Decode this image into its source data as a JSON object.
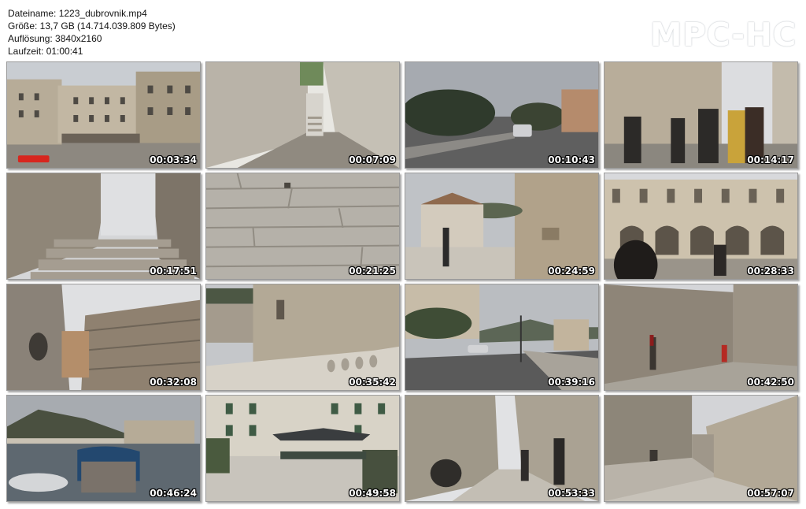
{
  "file_info": {
    "filename_line": "Dateiname: 1223_dubrovnik.mp4",
    "size_line": "Größe: 13,7 GB (14.714.039.809 Bytes)",
    "resolution_line": "Auflösung: 3840x2160",
    "duration_line": "Laufzeit: 01:00:41"
  },
  "logo_text": "MPC-HC",
  "thumbnails": [
    {
      "time": "00:03:34",
      "scene": "square-buildings"
    },
    {
      "time": "00:07:09",
      "scene": "stone-alley-stairs"
    },
    {
      "time": "00:10:43",
      "scene": "road-with-car"
    },
    {
      "time": "00:14:17",
      "scene": "street-people"
    },
    {
      "time": "00:17:51",
      "scene": "stone-stairs"
    },
    {
      "time": "00:21:25",
      "scene": "stone-wall"
    },
    {
      "time": "00:24:59",
      "scene": "terrace-person"
    },
    {
      "time": "00:28:33",
      "scene": "palace-arches"
    },
    {
      "time": "00:32:08",
      "scene": "fortress-corner"
    },
    {
      "time": "00:35:42",
      "scene": "wall-bridge"
    },
    {
      "time": "00:39:16",
      "scene": "coastal-road"
    },
    {
      "time": "00:42:50",
      "scene": "wall-passage"
    },
    {
      "time": "00:46:24",
      "scene": "harbor-boat"
    },
    {
      "time": "00:49:58",
      "scene": "cafe-square"
    },
    {
      "time": "00:53:33",
      "scene": "narrow-street"
    },
    {
      "time": "00:57:07",
      "scene": "walls-walkway"
    }
  ]
}
